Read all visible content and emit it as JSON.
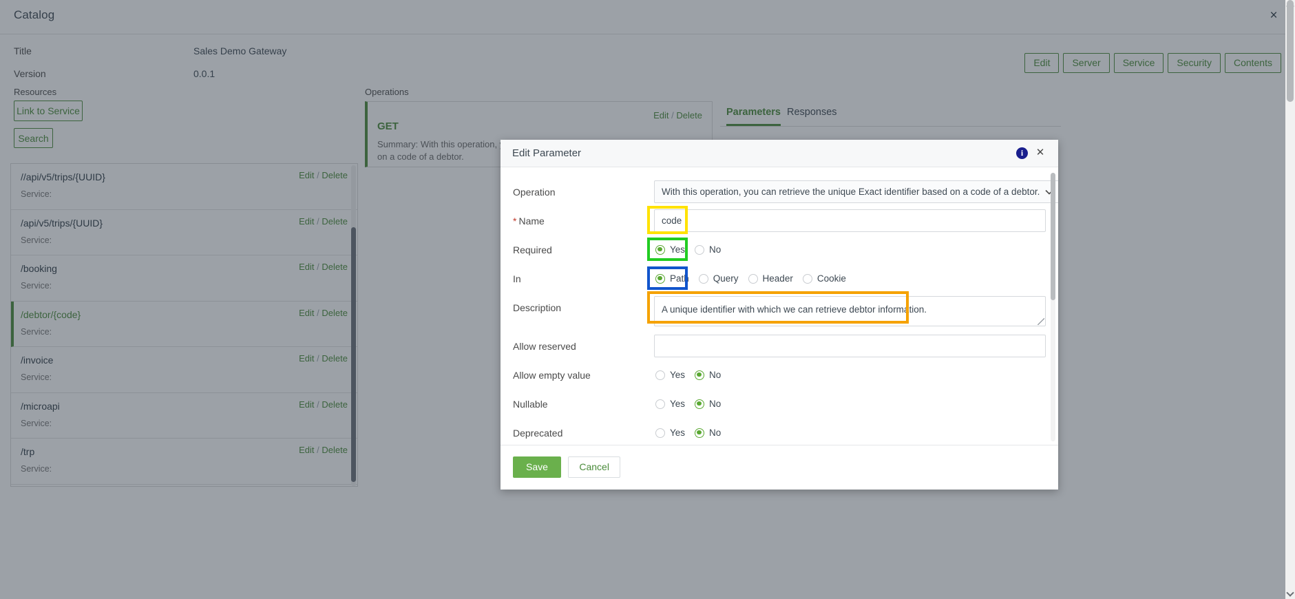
{
  "window": {
    "title": "Catalog",
    "close_label": "×"
  },
  "catalog": {
    "title_label": "Title",
    "title_value": "Sales Demo Gateway",
    "version_label": "Version",
    "version_value": "0.0.1",
    "resources_label": "Resources",
    "operations_label": "Operations",
    "link_to_service_label": "Link to Service",
    "search_label": "Search"
  },
  "top_buttons": [
    {
      "label": "Edit"
    },
    {
      "label": "Server"
    },
    {
      "label": "Service"
    },
    {
      "label": "Security"
    },
    {
      "label": "Contents"
    }
  ],
  "resources": [
    {
      "path": "//api/v5/trips/{UUID}",
      "service": "Service:",
      "edit": "Edit",
      "sep": "/",
      "delete": "Delete",
      "selected": false
    },
    {
      "path": "/api/v5/trips/{UUID}",
      "service": "Service:",
      "edit": "Edit",
      "sep": "/",
      "delete": "Delete",
      "selected": false
    },
    {
      "path": "/booking",
      "service": "Service:",
      "edit": "Edit",
      "sep": "/",
      "delete": "Delete",
      "selected": false
    },
    {
      "path": "/debtor/{code}",
      "service": "Service:",
      "edit": "Edit",
      "sep": "/",
      "delete": "Delete",
      "selected": true
    },
    {
      "path": "/invoice",
      "service": "Service:",
      "edit": "Edit",
      "sep": "/",
      "delete": "Delete",
      "selected": false
    },
    {
      "path": "/microapi",
      "service": "Service:",
      "edit": "Edit",
      "sep": "/",
      "delete": "Delete",
      "selected": false
    },
    {
      "path": "/trp",
      "service": "Service:",
      "edit": "Edit",
      "sep": "/",
      "delete": "Delete",
      "selected": false
    }
  ],
  "operation": {
    "method": "GET",
    "summary": "Summary: With this operation, you can retrieve the unique Exact identifier based on a code of a debtor.",
    "edit": "Edit",
    "sep": "/",
    "delete": "Delete"
  },
  "tabs": [
    {
      "label": "Parameters",
      "active": true
    },
    {
      "label": "Responses",
      "active": false
    }
  ],
  "modal": {
    "title": "Edit Parameter",
    "info_glyph": "i",
    "close_glyph": "✕",
    "fields": {
      "operation_label": "Operation",
      "operation_value": "With this operation, you can retrieve the unique Exact identifier based on a code of a debtor.",
      "operation_chevron": "⌄",
      "name_label": "Name",
      "name_required_star": "*",
      "name_value": "code",
      "required_label": "Required",
      "required_yes": "Yes",
      "required_no": "No",
      "required_selected": "Yes",
      "in_label": "In",
      "in_options": [
        "Path",
        "Query",
        "Header",
        "Cookie"
      ],
      "in_selected": "Path",
      "description_label": "Description",
      "description_value": "A unique identifier with which we can retrieve debtor information.",
      "allow_reserved_label": "Allow reserved",
      "allow_reserved_value": "",
      "allow_empty_label": "Allow empty value",
      "allow_empty_yes": "Yes",
      "allow_empty_no": "No",
      "allow_empty_selected": "No",
      "nullable_label": "Nullable",
      "nullable_yes": "Yes",
      "nullable_no": "No",
      "nullable_selected": "No",
      "deprecated_label": "Deprecated",
      "deprecated_yes": "Yes",
      "deprecated_no": "No",
      "deprecated_selected": "No"
    },
    "footer": {
      "save_label": "Save",
      "cancel_label": "Cancel"
    }
  },
  "highlights": {
    "name_color": "#FFE200",
    "required_color": "#22CC22",
    "in_color": "#1155CC",
    "description_color": "#F5A200"
  },
  "theme": {
    "accent_green": "#4a8b3a",
    "save_green": "#6ab04c",
    "info_blue": "#1a1f8e"
  }
}
